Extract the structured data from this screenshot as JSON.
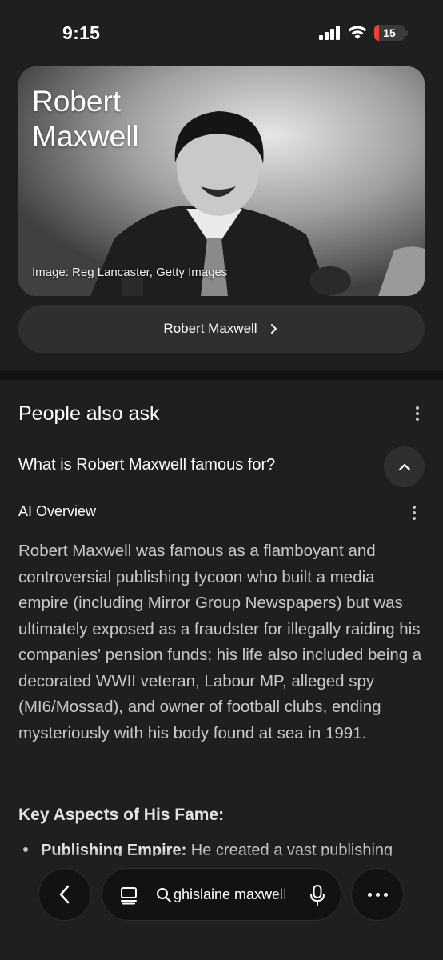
{
  "status_bar": {
    "time": "9:15",
    "battery_level": "15",
    "icons": [
      "signal-icon",
      "wifi-icon",
      "battery-icon"
    ]
  },
  "hero": {
    "title": "Robert Maxwell",
    "credit": "Image: Reg Lancaster, Getty Images"
  },
  "entity_link": {
    "label": "Robert Maxwell"
  },
  "people_also_ask": {
    "title": "People also ask",
    "question": "What is Robert Maxwell famous for?",
    "ai_overview_label": "AI Overview",
    "answer": "Robert Maxwell was famous as a flamboyant and controversial publishing tycoon who built a media empire (including Mirror Group Newspapers) but was ultimately exposed as a fraudster for illegally raiding his companies' pension funds; his life also included being a decorated WWII veteran, Labour MP, alleged spy (MI6/Mossad), and owner of football clubs, ending mysteriously with his body found at sea in 1991.",
    "section_heading": "Key Aspects of His Fame:",
    "bullet_title": "Publishing Empire:",
    "bullet_text": " He created a vast publishing"
  },
  "toolbar": {
    "search_query": "ghislaine maxwell"
  },
  "colors": {
    "background": "#1f1f1f",
    "pill": "#2e2f31",
    "battery_low": "#ea4335"
  }
}
